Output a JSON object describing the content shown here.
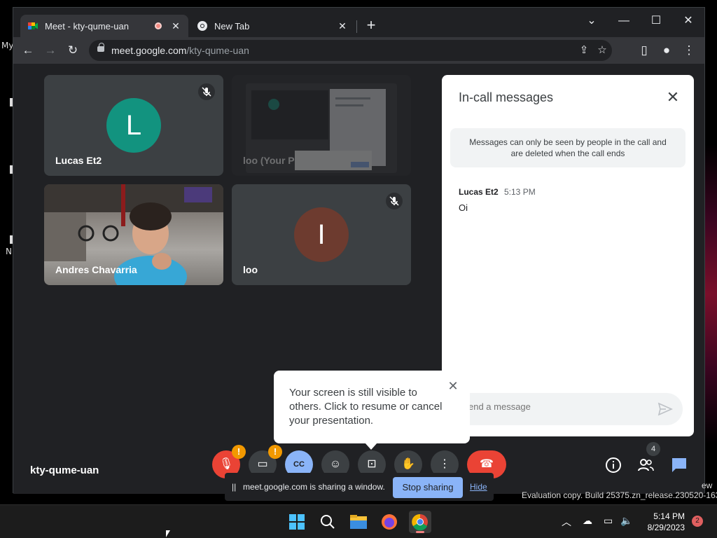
{
  "desktop": {
    "left_labels": [
      "My",
      "N"
    ],
    "watermark_line1": "ew",
    "watermark_line2": "Evaluation copy. Build 25375.zn_release.230520-1632"
  },
  "browser": {
    "tabs": [
      {
        "title": "Meet - kty-qume-uan",
        "recording": true
      },
      {
        "title": "New Tab"
      }
    ],
    "url_host": "meet.google.com",
    "url_path": "/kty-qume-uan"
  },
  "meet": {
    "participants": [
      {
        "name": "Lucas Et2",
        "avatar_letter": "L",
        "avatar_color": "#12937f",
        "muted": true
      },
      {
        "name": "loo (Your Presentation)",
        "visible_name": "loo (Your Pre",
        "presentation": true
      },
      {
        "name": "Andres Chavarria",
        "video": true
      },
      {
        "name": "loo",
        "avatar_letter": "I",
        "avatar_color": "#6d3b2f",
        "muted": true
      }
    ],
    "meeting_code": "kty-qume-uan",
    "people_count": "4"
  },
  "chat": {
    "title": "In-call messages",
    "notice": "Messages can only be seen by people in the call and are deleted when the call ends",
    "messages": [
      {
        "sender": "Lucas Et2",
        "time": "5:13 PM",
        "text": "Oi"
      }
    ],
    "input_placeholder": "end a message"
  },
  "tooltip": {
    "text": "Your screen is still visible to others. Click to resume or cancel your presentation."
  },
  "share_bar": {
    "pause_symbol": "||",
    "message": "meet.google.com is sharing a window.",
    "stop_label": "Stop sharing",
    "hide_label": "Hide"
  },
  "warn_badge": "!",
  "taskbar": {
    "time": "5:14 PM",
    "date": "8/29/2023",
    "notifications": "2"
  },
  "colors": {
    "meet_bg": "#202124",
    "accent_blue": "#8ab4f8",
    "end_call_red": "#ea4335",
    "warning_orange": "#f29900"
  }
}
